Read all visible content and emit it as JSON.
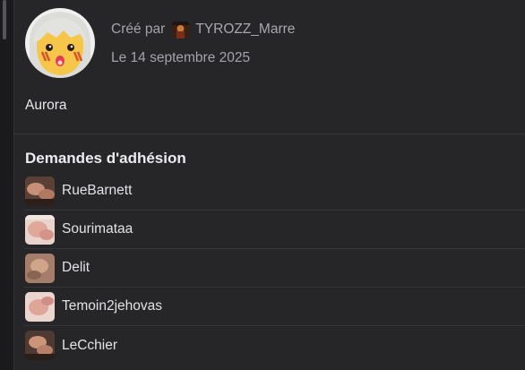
{
  "group": {
    "created_by_label": "Créé par",
    "creator_name": "TYROZZ_Marre",
    "date": "Le 14 septembre 2025",
    "name": "Aurora"
  },
  "requests": {
    "title": "Demandes d'adhésion",
    "items": [
      {
        "username": "RueBarnett",
        "thumb": "dark"
      },
      {
        "username": "Sourimataa",
        "thumb": "light"
      },
      {
        "username": "Delit",
        "thumb": "tan"
      },
      {
        "username": "Temoin2jehovas",
        "thumb": "light"
      },
      {
        "username": "LeCchier",
        "thumb": "dark"
      }
    ]
  },
  "colors": {
    "panel_bg": "#262629",
    "page_bg": "#1a1a1c",
    "text_primary": "#e8e8ec",
    "text_secondary": "#a3a3aa",
    "divider": "#36363a"
  }
}
